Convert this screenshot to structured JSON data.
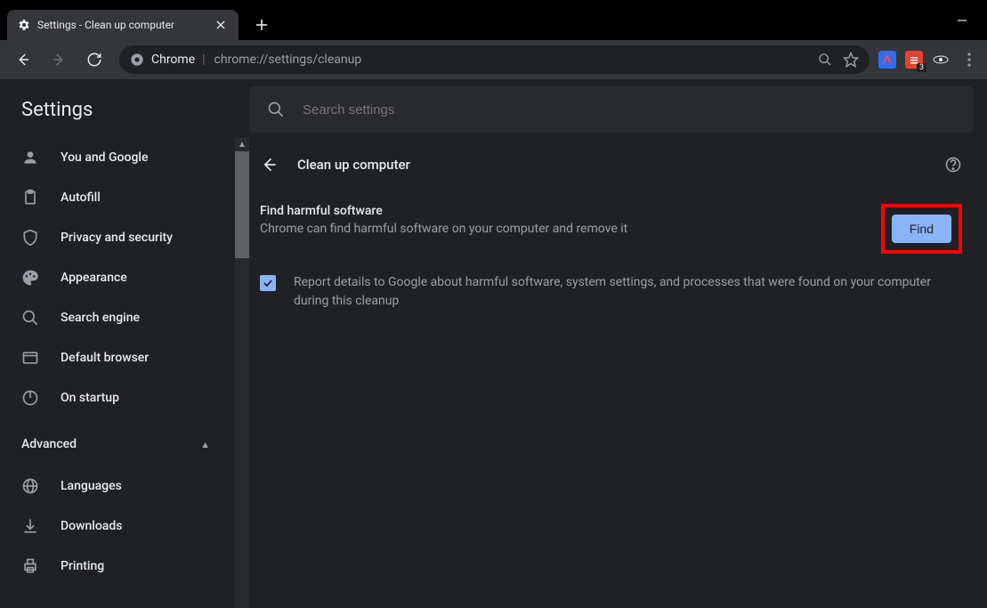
{
  "window": {
    "tab_title": "Settings - Clean up computer"
  },
  "omnibox": {
    "scheme_label": "Chrome",
    "url": "chrome://settings/cleanup"
  },
  "ext_badge": "3",
  "settings_header": "Settings",
  "search": {
    "placeholder": "Search settings"
  },
  "sidebar": {
    "items": [
      {
        "label": "You and Google"
      },
      {
        "label": "Autofill"
      },
      {
        "label": "Privacy and security"
      },
      {
        "label": "Appearance"
      },
      {
        "label": "Search engine"
      },
      {
        "label": "Default browser"
      },
      {
        "label": "On startup"
      }
    ],
    "advanced_label": "Advanced",
    "adv_items": [
      {
        "label": "Languages"
      },
      {
        "label": "Downloads"
      },
      {
        "label": "Printing"
      }
    ]
  },
  "page": {
    "title": "Clean up computer",
    "find_title": "Find harmful software",
    "find_desc": "Chrome can find harmful software on your computer and remove it",
    "find_button": "Find",
    "report_text": "Report details to Google about harmful software, system settings, and processes that were found on your computer during this cleanup",
    "report_checked": true
  }
}
